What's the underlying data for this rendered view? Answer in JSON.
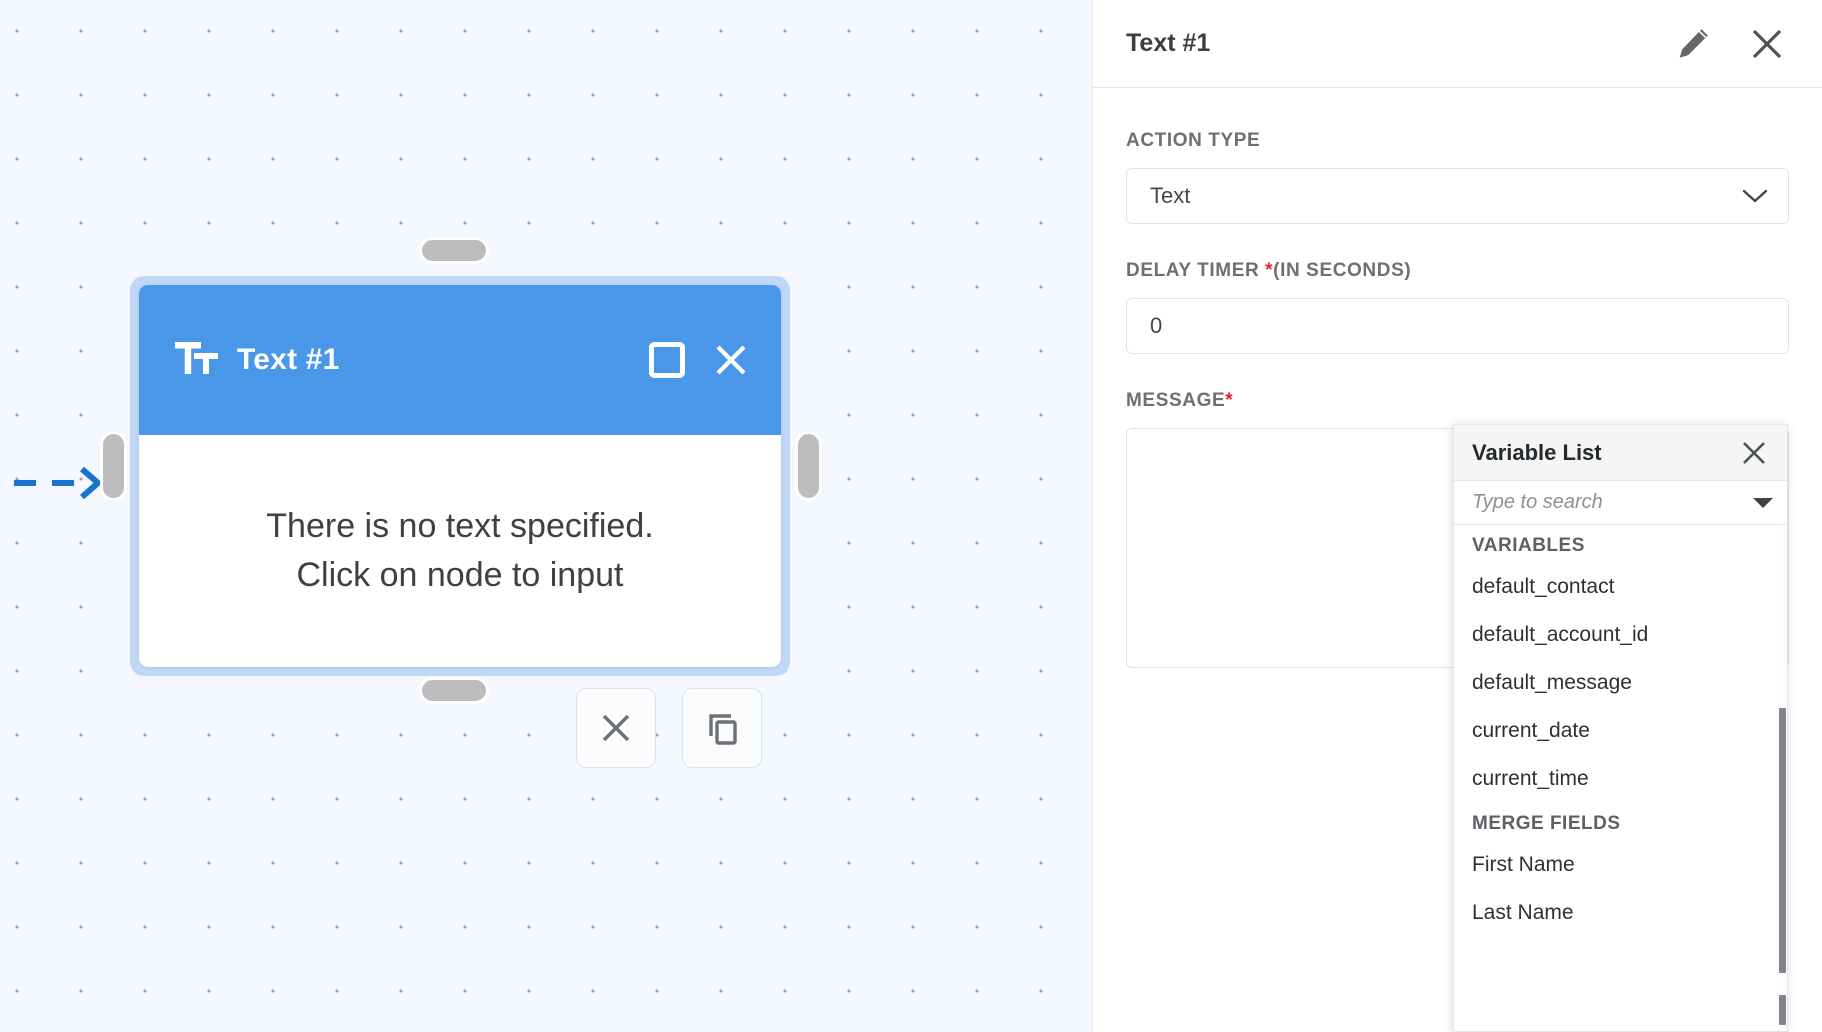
{
  "canvas": {
    "node": {
      "icon": "text-format-tt-icon",
      "title": "Text #1",
      "body_lines": [
        "There is no text specified.",
        "Click on node to input"
      ],
      "header_color": "#4a96e8",
      "selection_ring_color": "#bfd8f7",
      "maximize_icon": "square-icon",
      "close_icon": "close-x-icon"
    },
    "actions": [
      {
        "icon": "close-x-icon",
        "name": "delete-node-button"
      },
      {
        "icon": "copy-icon",
        "name": "duplicate-node-button"
      }
    ],
    "edge_color": "#1873cf"
  },
  "panel": {
    "title": "Text #1",
    "edit_icon": "pencil-icon",
    "close_icon": "close-x-icon",
    "fields": {
      "action_type": {
        "label": "ACTION TYPE",
        "value": "Text",
        "chevron_icon": "chevron-down-icon"
      },
      "delay_timer": {
        "label_before": "DELAY TIMER ",
        "required_mark": "*",
        "label_after": "(IN SECONDS)",
        "value": "0"
      },
      "message": {
        "label": "MESSAGE",
        "required_mark": "*",
        "value": ""
      }
    }
  },
  "variable_list": {
    "title": "Variable List",
    "close_icon": "close-x-icon",
    "search": {
      "value": "",
      "placeholder": "Type to search",
      "caret_icon": "caret-down-icon"
    },
    "groups": [
      {
        "label": "VARIABLES",
        "items": [
          "default_contact",
          "default_account_id",
          "default_message",
          "current_date",
          "current_time"
        ]
      },
      {
        "label": "MERGE FIELDS",
        "items": [
          "First Name",
          "Last Name"
        ]
      }
    ]
  }
}
